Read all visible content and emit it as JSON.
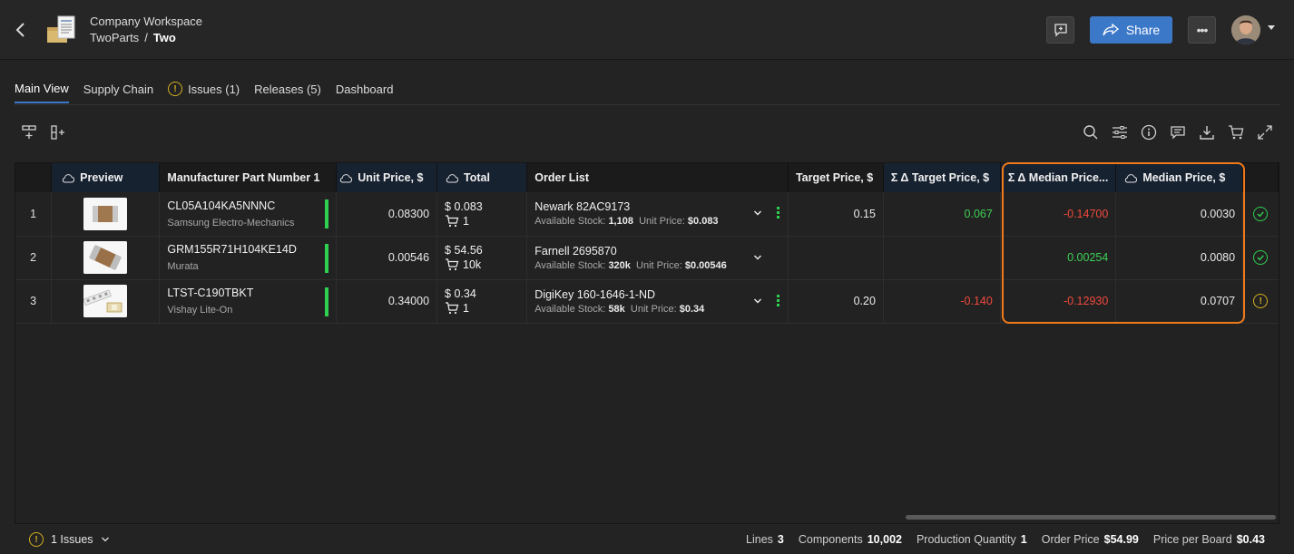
{
  "header": {
    "workspace": "Company Workspace",
    "project": "TwoParts",
    "separator": "/",
    "current": "Two",
    "share_label": "Share",
    "more_label": "•••"
  },
  "tabs": [
    {
      "label": "Main View"
    },
    {
      "label": "Supply Chain"
    },
    {
      "label": "Issues (1)"
    },
    {
      "label": "Releases (5)"
    },
    {
      "label": "Dashboard"
    }
  ],
  "table": {
    "columns": {
      "preview": "Preview",
      "mpn": "Manufacturer Part Number 1",
      "unit_price": "Unit Price, $",
      "total": "Total",
      "order_list": "Order List",
      "target_price": "Target Price, $",
      "delta_target": "Σ  Δ Target Price, $",
      "delta_median": "Σ  Δ Median Price...",
      "median_price": "Median Price, $"
    },
    "rows": [
      {
        "index": "1",
        "mpn": "CL05A104KA5NNNC",
        "manufacturer": "Samsung Electro-Mechanics",
        "unit_price": "0.08300",
        "total_price": "$ 0.083",
        "total_qty": "1",
        "supplier": "Newark 82AC9173",
        "stock_label": "Available Stock:",
        "stock": "1,108",
        "unit_label": "Unit Price:",
        "supplier_unit": "$0.083",
        "target_price": "0.15",
        "delta_target": "0.067",
        "delta_median": "-0.14700",
        "median_price": "0.0030",
        "status": "ok"
      },
      {
        "index": "2",
        "mpn": "GRM155R71H104KE14D",
        "manufacturer": "Murata",
        "unit_price": "0.00546",
        "total_price": "$ 54.56",
        "total_qty": "10k",
        "supplier": "Farnell 2695870",
        "stock_label": "Available Stock:",
        "stock": "320k",
        "unit_label": "Unit Price:",
        "supplier_unit": "$0.00546",
        "target_price": "",
        "delta_target": "",
        "delta_median": "0.00254",
        "median_price": "0.0080",
        "status": "ok"
      },
      {
        "index": "3",
        "mpn": "LTST-C190TBKT",
        "manufacturer": "Vishay Lite-On",
        "unit_price": "0.34000",
        "total_price": "$ 0.34",
        "total_qty": "1",
        "supplier": "DigiKey 160-1646-1-ND",
        "stock_label": "Available Stock:",
        "stock": "58k",
        "unit_label": "Unit Price:",
        "supplier_unit": "$0.34",
        "target_price": "0.20",
        "delta_target": "-0.140",
        "delta_median": "-0.12930",
        "median_price": "0.0707",
        "status": "warning"
      }
    ]
  },
  "footer": {
    "issues": "1 Issues",
    "lines_label": "Lines",
    "lines": "3",
    "components_label": "Components",
    "components": "10,002",
    "production_label": "Production Quantity",
    "production": "1",
    "order_label": "Order Price",
    "order": "$54.99",
    "board_label": "Price per Board",
    "board": "$0.43"
  },
  "colors": {
    "accent": "#3c78c8",
    "positive": "#3fcf55",
    "negative": "#f0493c",
    "warning": "#d4b020",
    "highlight": "#f07a1a"
  },
  "icons": [
    "back-icon",
    "workspace-icon",
    "add-comment-icon",
    "share-icon",
    "more-icon",
    "avatar",
    "add-row-icon",
    "add-column-icon",
    "search-icon",
    "filter-icon",
    "info-icon",
    "comments-icon",
    "download-icon",
    "cart-icon",
    "expand-icon",
    "cloud-icon",
    "check-circle-icon",
    "warning-icon",
    "chevron-down-icon"
  ]
}
